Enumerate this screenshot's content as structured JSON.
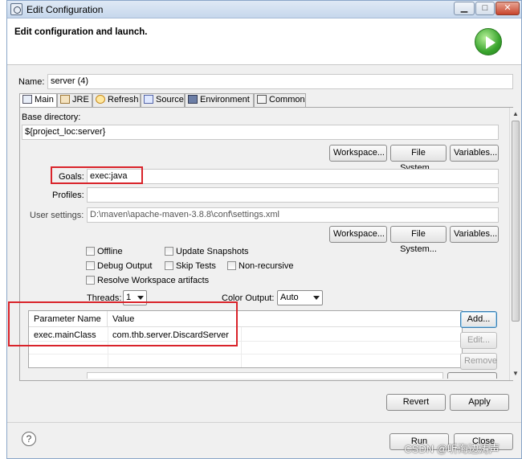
{
  "window": {
    "title": "Edit Configuration",
    "min_glyph": "▁",
    "max_glyph": "□",
    "close_glyph": "✕"
  },
  "header": {
    "title": "Edit configuration and launch."
  },
  "name": {
    "label": "Name:",
    "value": "server (4)"
  },
  "tabs": [
    {
      "label": "Main",
      "icon": "main-tab-icon"
    },
    {
      "label": "JRE",
      "icon": "jre-icon"
    },
    {
      "label": "Refresh",
      "icon": "refresh-icon"
    },
    {
      "label": "Source",
      "icon": "source-icon"
    },
    {
      "label": "Environment",
      "icon": "environment-icon"
    },
    {
      "label": "Common",
      "icon": "common-icon"
    }
  ],
  "main": {
    "base_dir_label": "Base directory:",
    "base_dir_value": "${project_loc:server}",
    "workspace_btn": "Workspace...",
    "filesystem_btn": "File System...",
    "variables_btn": "Variables...",
    "goals_label": "Goals:",
    "goals_value": "exec:java",
    "profiles_label": "Profiles:",
    "profiles_value": "",
    "user_settings_label": "User settings:",
    "user_settings_value": "D:\\maven\\apache-maven-3.8.8\\conf\\settings.xml",
    "checkboxes": {
      "offline": "Offline",
      "update_snapshots": "Update Snapshots",
      "debug_output": "Debug Output",
      "skip_tests": "Skip Tests",
      "non_recursive": "Non-recursive",
      "resolve_workspace": "Resolve Workspace artifacts"
    },
    "threads_label": "Threads:",
    "threads_value": "1",
    "color_output_label": "Color Output:",
    "color_output_value": "Auto",
    "params": {
      "headers": [
        "Parameter Name",
        "Value"
      ],
      "rows": [
        {
          "name": "exec.mainClass",
          "value": "com.thb.server.DiscardServer"
        }
      ]
    },
    "add_btn": "Add...",
    "edit_btn": "Edit...",
    "remove_btn": "Remove"
  },
  "actions": {
    "revert": "Revert",
    "apply": "Apply",
    "run": "Run",
    "close": "Close"
  },
  "watermark": "CSDN @听海边涛声",
  "colors": {
    "highlight": "#d9232a",
    "accent": "#3c7fb1"
  }
}
